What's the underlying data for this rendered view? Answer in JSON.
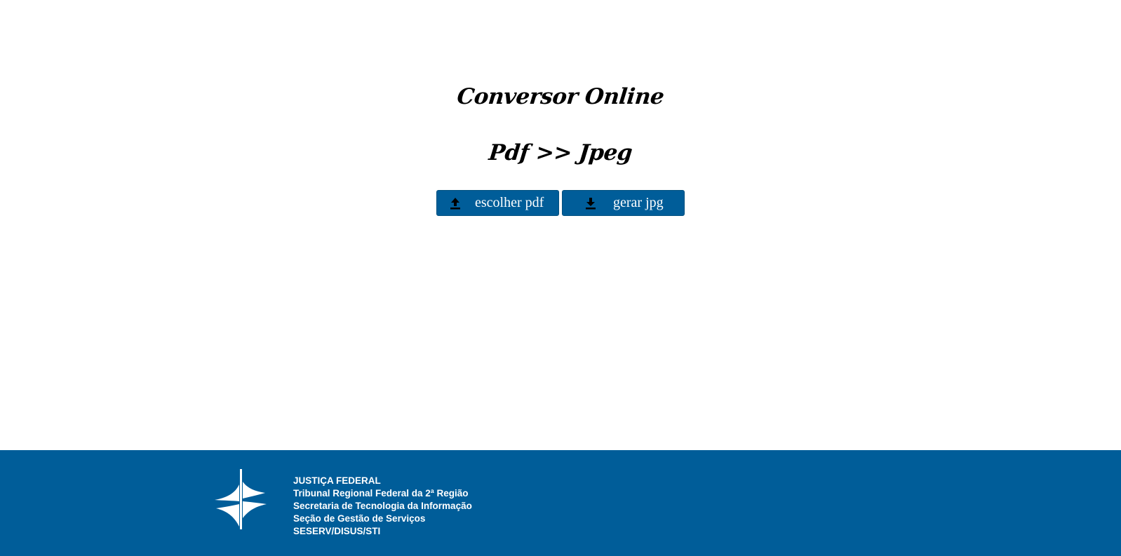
{
  "main": {
    "title": "Conversor Online",
    "subtitle": "Pdf >> Jpeg",
    "buttons": {
      "upload": {
        "label": "escolher pdf",
        "icon": "upload-icon"
      },
      "download": {
        "label": "gerar jpg",
        "icon": "download-icon"
      }
    }
  },
  "footer": {
    "logo": "justica-federal-logo",
    "lines": [
      "JUSTIÇA FEDERAL",
      "Tribunal Regional Federal da 2ª Região",
      "Secretaria de Tecnologia da Informação",
      "Seção de Gestão de Serviços",
      "SESERV/DISUS/STI"
    ]
  },
  "colors": {
    "accent": "#005d99",
    "text": "#000000",
    "background": "#ffffff"
  }
}
